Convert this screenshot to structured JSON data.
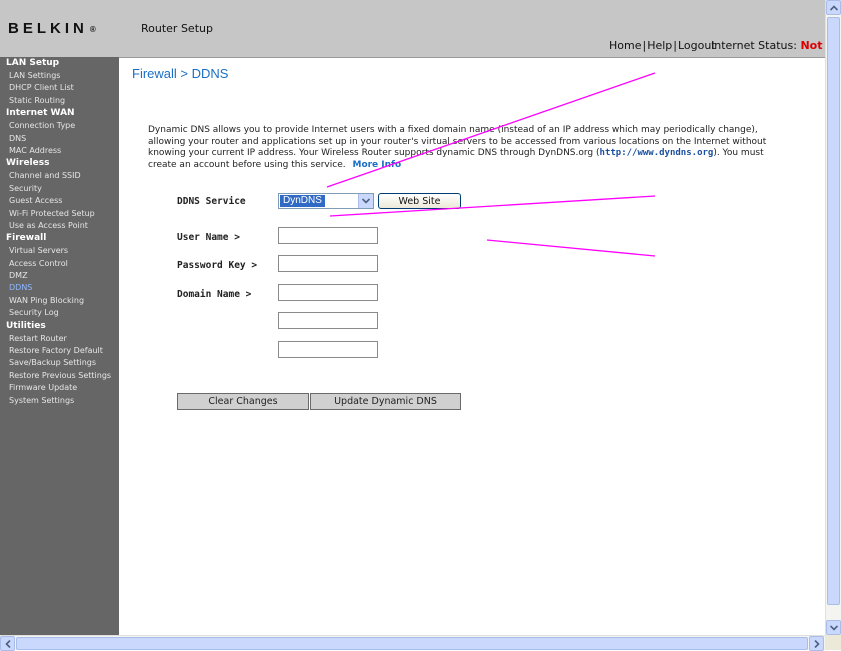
{
  "header": {
    "logo": "BELKIN",
    "logo_mark": "®",
    "app_title": "Router Setup",
    "links": [
      "Home",
      "Help",
      "Logout"
    ],
    "internet_status_label": "Internet Status:",
    "internet_status_value": "Not Co"
  },
  "sidebar": {
    "groups": [
      {
        "title": "LAN Setup",
        "items": [
          "LAN Settings",
          "DHCP Client List",
          "Static Routing"
        ]
      },
      {
        "title": "Internet WAN",
        "items": [
          "Connection Type",
          "DNS",
          "MAC Address"
        ]
      },
      {
        "title": "Wireless",
        "items": [
          "Channel and SSID",
          "Security",
          "Guest Access",
          "Wi-Fi Protected Setup",
          "Use as Access Point"
        ]
      },
      {
        "title": "Firewall",
        "items": [
          "Virtual Servers",
          "Access Control",
          "DMZ",
          "DDNS",
          "WAN Ping Blocking",
          "Security Log"
        ]
      },
      {
        "title": "Utilities",
        "items": [
          "Restart Router",
          "Restore Factory Default",
          "Save/Backup Settings",
          "Restore Previous Settings",
          "Firmware Update",
          "System Settings"
        ]
      }
    ],
    "active_item": "DDNS"
  },
  "main": {
    "title": "Firewall > DDNS",
    "intro_text": "Dynamic DNS allows you to provide Internet users with a fixed domain name (instead of an IP address which may periodically change), allowing your router and applications set up in your router's virtual servers to be accessed from various locations on the Internet without knowing your current IP address. Your Wireless Router supports dynamic DNS through DynDNS.org",
    "intro_link": "http://www.dyndns.org",
    "intro_tail": "). You must create an account before using this service.",
    "more_info": "More Info",
    "ddns_service_label": "DDNS Service",
    "ddns_service_value": "DynDNS",
    "website_button": "Web Site",
    "username_label": "User Name >",
    "username_value": "",
    "password_label": "Password Key >",
    "password_value": "",
    "domain_label": "Domain Name >",
    "domain_value": "",
    "extra_field_1": "",
    "extra_field_2": "",
    "clear_button": "Clear Changes",
    "update_button": "Update Dynamic DNS"
  },
  "colors": {
    "annotation": "#ff00ff",
    "title_blue": "#1a6fc4",
    "status_red": "#dd0000",
    "sidebar_bg": "#666666"
  }
}
